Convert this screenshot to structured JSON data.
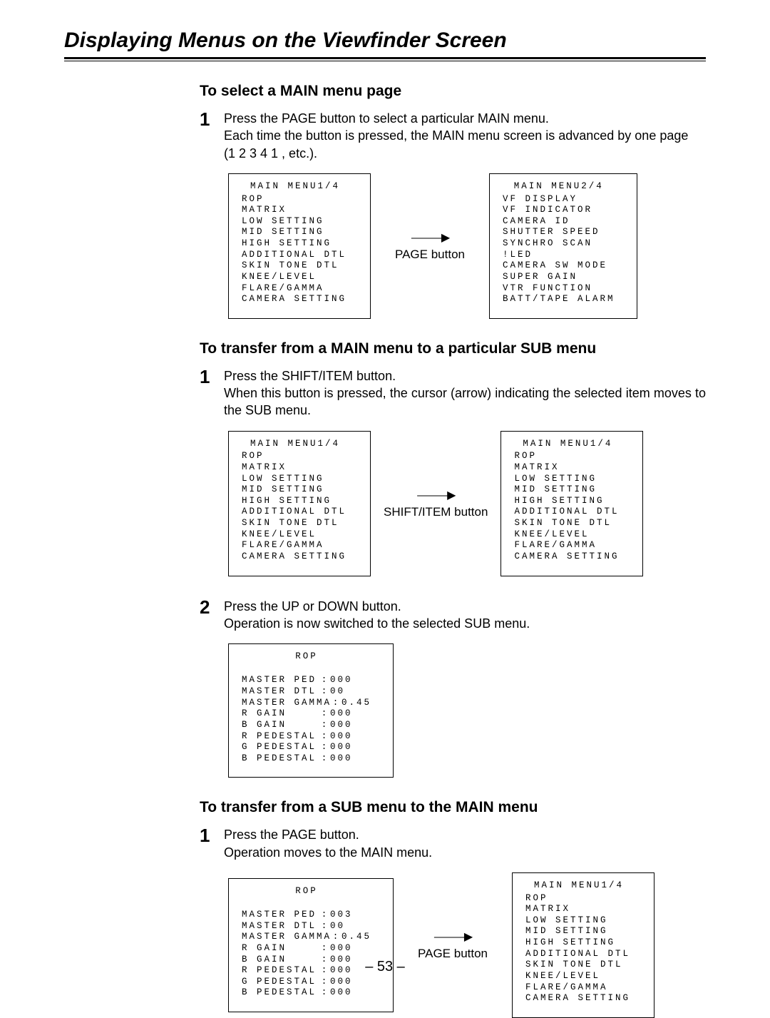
{
  "page_title": "Displaying Menus on the Viewfinder Screen",
  "s1": {
    "heading": "To select a MAIN menu page",
    "step_num": "1",
    "step_para1": "Press the PAGE button to select a particular MAIN menu.",
    "step_para2": "Each time the button is pressed, the MAIN menu screen is advanced by one page",
    "step_para3": "(1   2   3   4   1   , etc.).",
    "arrow_label": "PAGE button",
    "left": {
      "title": "MAIN MENU1/4",
      "items": [
        "ROP",
        "MATRIX",
        "LOW SETTING",
        "MID SETTING",
        "HIGH SETTING",
        "ADDITIONAL DTL",
        "SKIN TONE DTL",
        "KNEE/LEVEL",
        "FLARE/GAMMA",
        "CAMERA SETTING"
      ]
    },
    "right": {
      "title": "MAIN MENU2/4",
      "items": [
        "VF DISPLAY",
        "VF INDICATOR",
        "CAMERA ID",
        "SHUTTER SPEED",
        "SYNCHRO SCAN",
        "!LED",
        "CAMERA SW MODE",
        "SUPER GAIN",
        "VTR FUNCTION",
        "BATT/TAPE ALARM"
      ]
    }
  },
  "s2": {
    "heading": "To transfer from a MAIN menu to a particular SUB menu",
    "step1_num": "1",
    "step1_para1": "Press the SHIFT/ITEM button.",
    "step1_para2": "When this button is pressed, the cursor (arrow) indicating the selected item moves to the SUB menu.",
    "arrow_label": "SHIFT/ITEM button",
    "left": {
      "title": "MAIN MENU1/4",
      "items": [
        "ROP",
        "MATRIX",
        "LOW SETTING",
        "MID SETTING",
        "HIGH SETTING",
        "ADDITIONAL DTL",
        "SKIN TONE DTL",
        "KNEE/LEVEL",
        "FLARE/GAMMA",
        "CAMERA SETTING"
      ]
    },
    "right": {
      "title": "MAIN MENU1/4",
      "items": [
        "ROP",
        "MATRIX",
        "LOW SETTING",
        "MID SETTING",
        "HIGH SETTING",
        "ADDITIONAL DTL",
        "SKIN TONE DTL",
        "KNEE/LEVEL",
        "FLARE/GAMMA",
        "CAMERA SETTING"
      ]
    },
    "step2_num": "2",
    "step2_para1": "Press the UP or DOWN button.",
    "step2_para2": "Operation is now switched to the selected SUB menu.",
    "sub": {
      "title": "ROP",
      "rows": [
        {
          "k": "MASTER PED",
          "c": ":",
          "v": "000"
        },
        {
          "k": "MASTER DTL",
          "c": ":",
          "v": "00"
        },
        {
          "k": "MASTER GAMMA",
          "c": ":",
          "v": "0.45"
        },
        {
          "k": "R GAIN",
          "c": ":",
          "v": "000"
        },
        {
          "k": "B GAIN",
          "c": ":",
          "v": "000"
        },
        {
          "k": "R PEDESTAL",
          "c": ":",
          "v": "000"
        },
        {
          "k": "G PEDESTAL",
          "c": ":",
          "v": "000"
        },
        {
          "k": "B PEDESTAL",
          "c": ":",
          "v": "000"
        }
      ]
    }
  },
  "s3": {
    "heading": "To transfer from a SUB menu to the MAIN menu",
    "step_num": "1",
    "step_para1": "Press the PAGE button.",
    "step_para2": "Operation moves to the MAIN menu.",
    "arrow_label": "PAGE button",
    "left": {
      "title": "ROP",
      "rows": [
        {
          "k": "MASTER PED",
          "c": ":",
          "v": "003"
        },
        {
          "k": "MASTER DTL",
          "c": ":",
          "v": "00"
        },
        {
          "k": "MASTER GAMMA",
          "c": ":",
          "v": "0.45"
        },
        {
          "k": "R GAIN",
          "c": ":",
          "v": "000"
        },
        {
          "k": "B GAIN",
          "c": ":",
          "v": "000"
        },
        {
          "k": "R PEDESTAL",
          "c": ":",
          "v": "000"
        },
        {
          "k": "G PEDESTAL",
          "c": ":",
          "v": "000"
        },
        {
          "k": "B PEDESTAL",
          "c": ":",
          "v": "000"
        }
      ]
    },
    "right": {
      "title": "MAIN MENU1/4",
      "items": [
        "ROP",
        "MATRIX",
        "LOW SETTING",
        "MID SETTING",
        "HIGH SETTING",
        "ADDITIONAL DTL",
        "SKIN TONE DTL",
        "KNEE/LEVEL",
        "FLARE/GAMMA",
        "CAMERA SETTING"
      ]
    }
  },
  "page_number": "– 53 –"
}
